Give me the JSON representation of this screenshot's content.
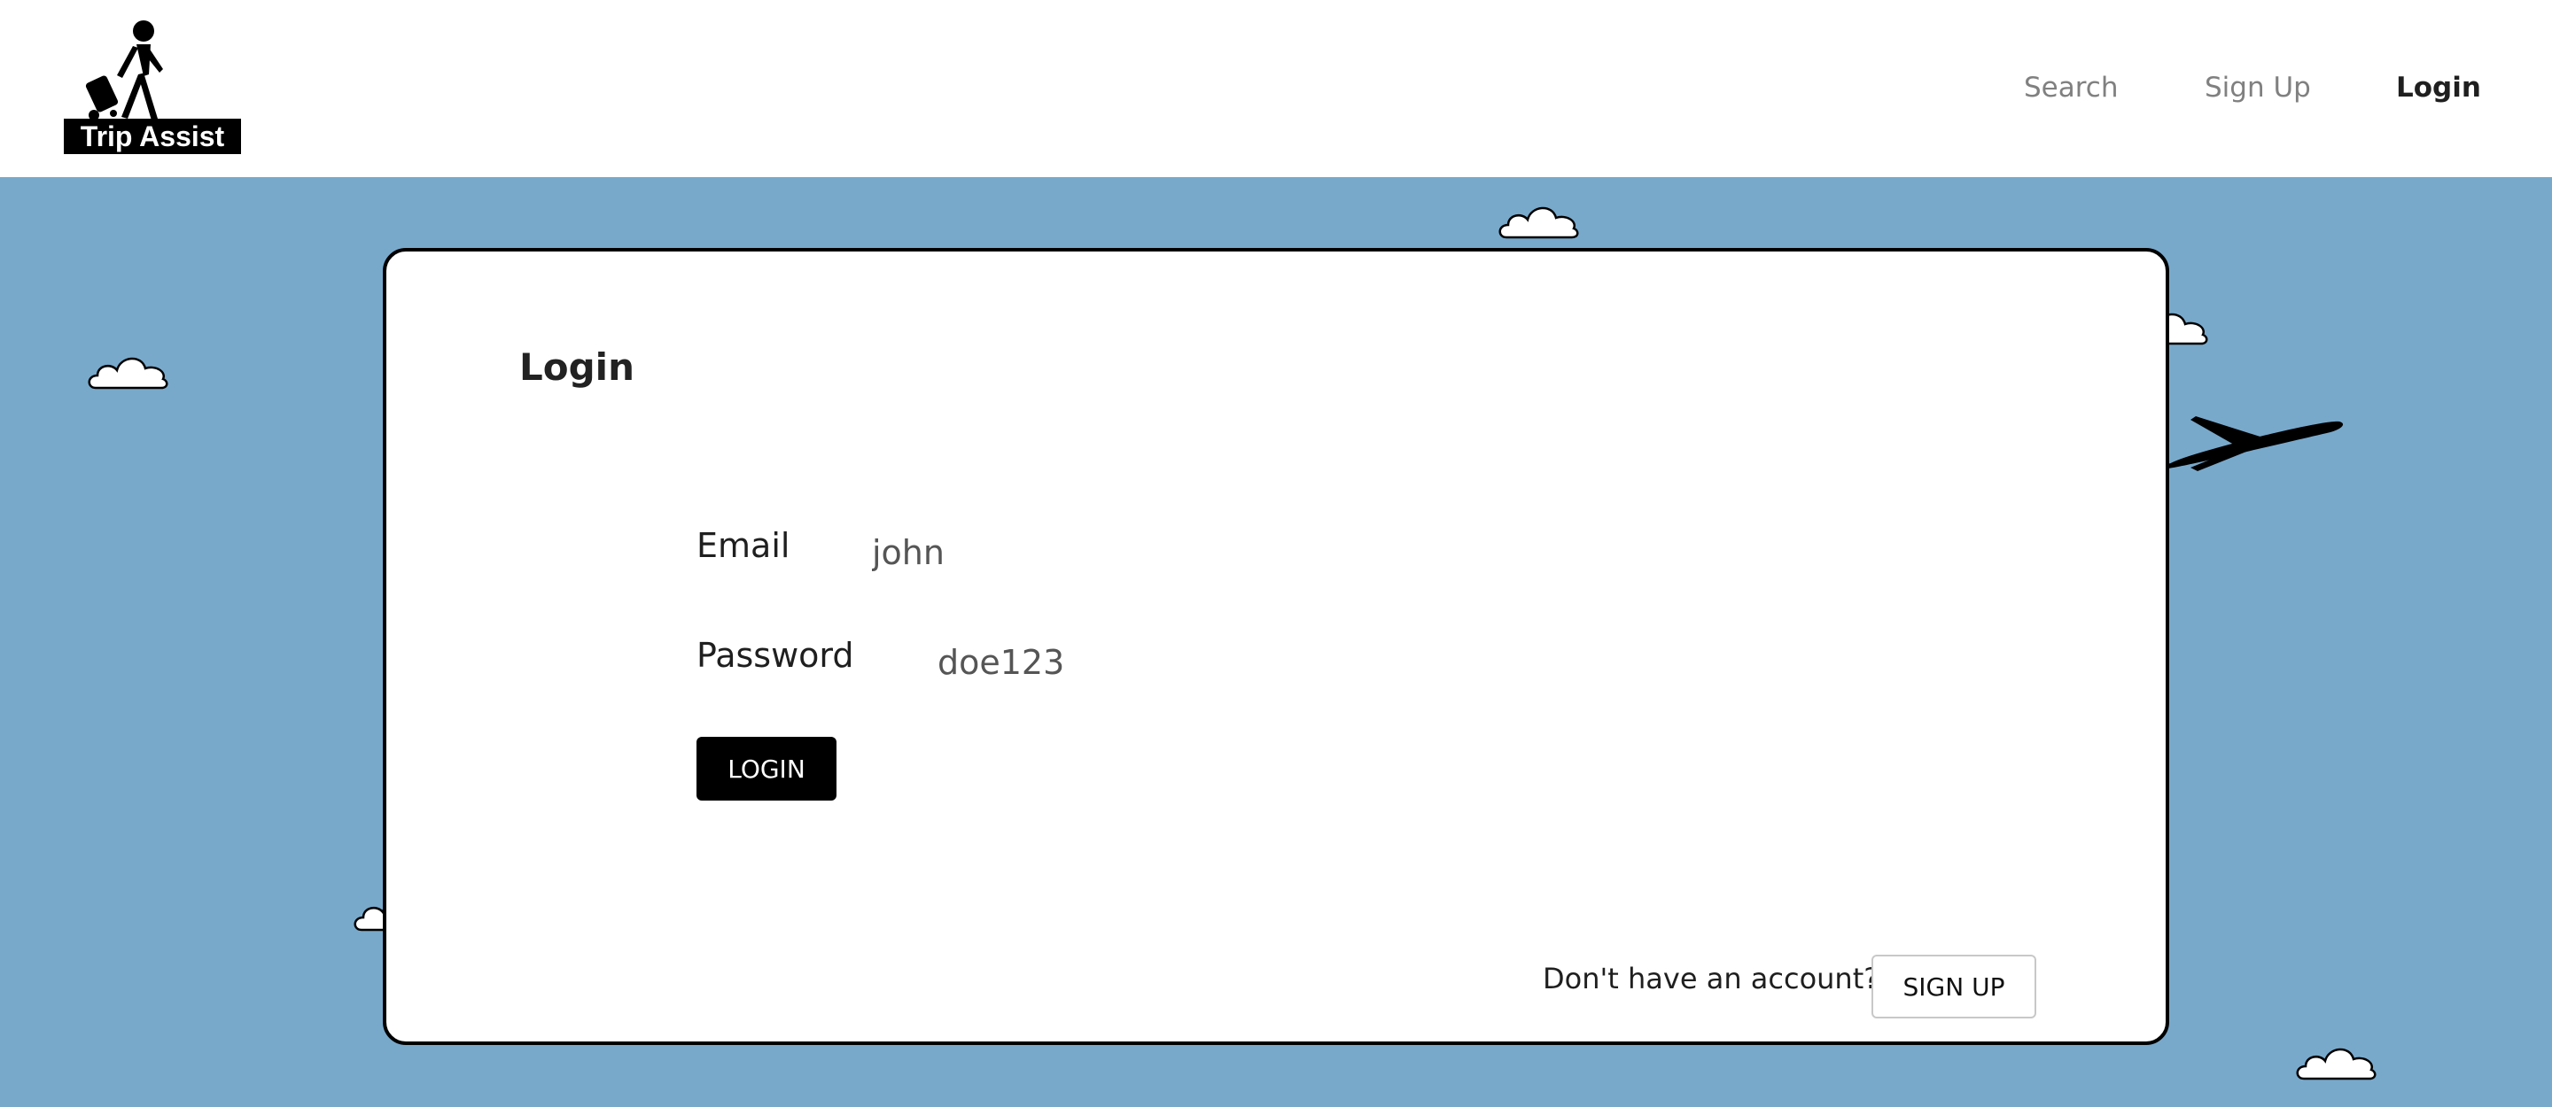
{
  "brand": {
    "name": "Trip Assist"
  },
  "nav": {
    "search": "Search",
    "signup": "Sign Up",
    "login": "Login"
  },
  "login_card": {
    "title": "Login",
    "email_label": "Email",
    "email_value": "john",
    "password_label": "Password",
    "password_value": "doe123",
    "login_button": "LOGIN",
    "no_account_text": "Don't have an account?",
    "signup_button": "SIGN UP"
  },
  "colors": {
    "sky": "#78a9cb",
    "primary_button": "#000000",
    "active_nav": "#1f1f1f",
    "inactive_nav": "#808080"
  },
  "icons": [
    "traveler-logo-icon",
    "cloud-icon",
    "airplane-icon"
  ]
}
